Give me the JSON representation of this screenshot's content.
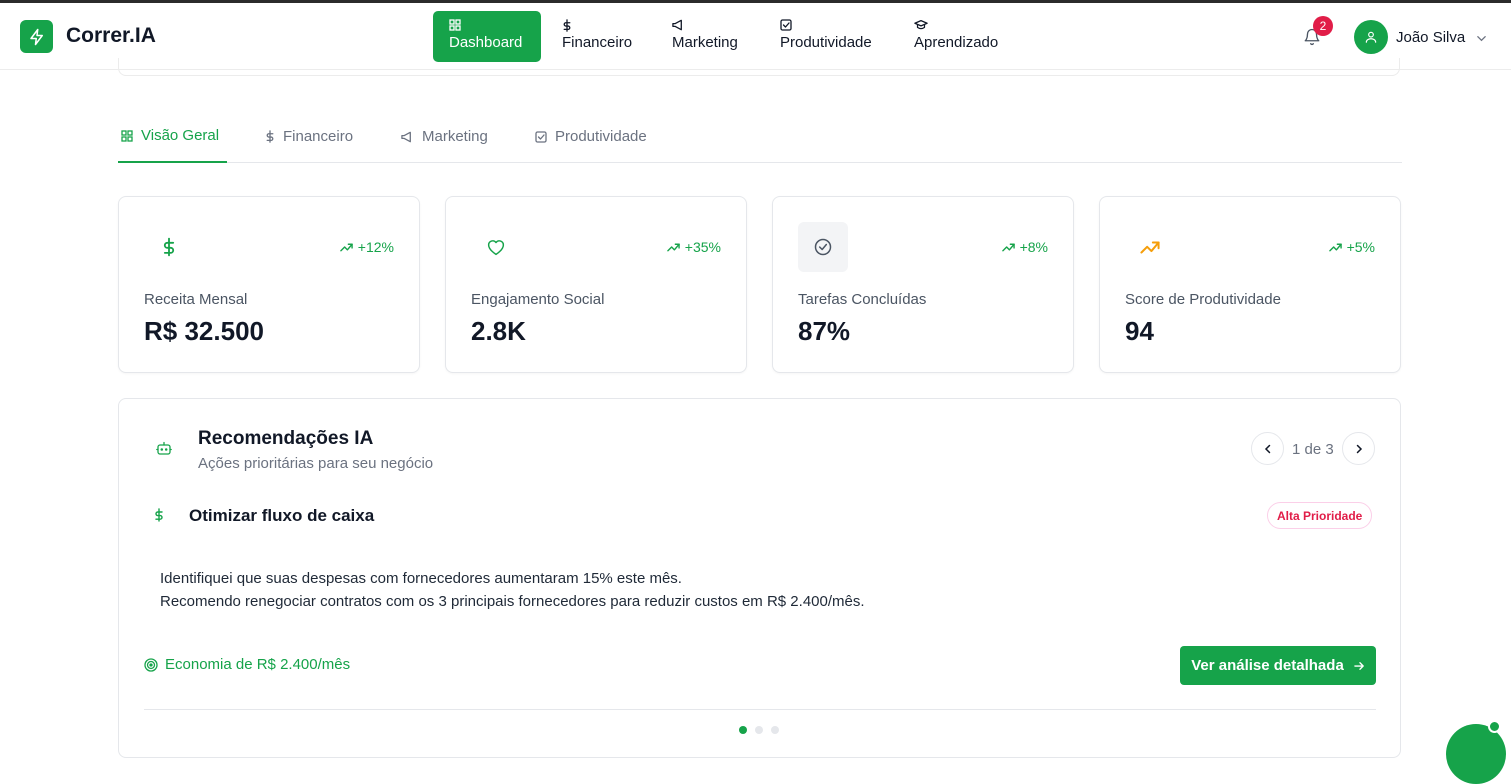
{
  "app": {
    "brand": "Correr.IA"
  },
  "nav": [
    {
      "label": "Dashboard",
      "icon": "grid-icon",
      "active": true
    },
    {
      "label": "Financeiro",
      "icon": "dollar-icon"
    },
    {
      "label": "Marketing",
      "icon": "megaphone-icon"
    },
    {
      "label": "Produtividade",
      "icon": "checkbox-icon"
    },
    {
      "label": "Aprendizado",
      "icon": "graduation-cap-icon"
    }
  ],
  "notifications": {
    "count": "2"
  },
  "user": {
    "name": "João Silva"
  },
  "tabs": [
    {
      "label": "Visão Geral",
      "icon": "grid-icon",
      "active": true
    },
    {
      "label": "Financeiro",
      "icon": "dollar-icon"
    },
    {
      "label": "Marketing",
      "icon": "megaphone-icon"
    },
    {
      "label": "Produtividade",
      "icon": "checkbox-icon"
    }
  ],
  "stats": [
    {
      "label": "Receita Mensal",
      "value": "R$ 32.500",
      "change": "+12%",
      "icon": "dollar-icon"
    },
    {
      "label": "Engajamento Social",
      "value": "2.8K",
      "change": "+35%",
      "icon": "heart-icon"
    },
    {
      "label": "Tarefas Concluídas",
      "value": "87%",
      "change": "+8%",
      "icon": "check-circle-icon"
    },
    {
      "label": "Score de Produtividade",
      "value": "94",
      "change": "+5%",
      "icon": "trending-up-icon"
    }
  ],
  "recommendations": {
    "title": "Recomendações IA",
    "subtitle": "Ações prioritárias para seu negócio",
    "pager": "1 de 3",
    "item": {
      "title": "Otimizar fluxo de caixa",
      "priority": "Alta Prioridade",
      "description_line1": "Identifiquei que suas despesas com fornecedores aumentaram 15% este mês.",
      "description_line2": "Recomendo renegociar contratos com os 3 principais fornecedores para reduzir custos em R$ 2.400/mês.",
      "economy": "Economia de R$ 2.400/mês",
      "cta": "Ver análise detalhada"
    }
  },
  "colors": {
    "accent": "#16a34a",
    "danger": "#e11d48",
    "warning": "#f59e0b"
  }
}
